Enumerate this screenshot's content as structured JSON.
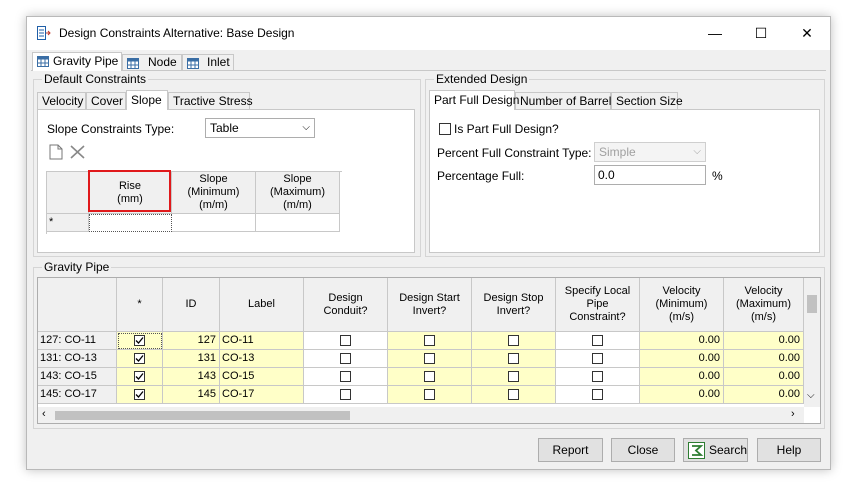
{
  "window": {
    "title": "Design Constraints Alternative:  Base Design",
    "controls": {
      "minimize": "—",
      "maximize": "☐",
      "close": "✕"
    }
  },
  "top_tabs": [
    {
      "label": "Gravity Pipe",
      "icon": "grid-icon"
    },
    {
      "label": "Node",
      "icon": "grid-icon"
    },
    {
      "label": "Inlet",
      "icon": "grid-icon"
    }
  ],
  "default_constraints": {
    "legend": "Default Constraints",
    "tabs": [
      "Velocity",
      "Cover",
      "Slope",
      "Tractive Stress"
    ],
    "slope_constraints_type_label": "Slope Constraints Type:",
    "slope_constraints_type_value": "Table",
    "grid": {
      "columns": [
        {
          "line1": "Rise",
          "line2": "(mm)",
          "line3": ""
        },
        {
          "line1": "Slope",
          "line2": "(Minimum)",
          "line3": "(m/m)"
        },
        {
          "line1": "Slope",
          "line2": "(Maximum)",
          "line3": "(m/m)"
        }
      ],
      "new_row_marker": "*"
    }
  },
  "extended_design": {
    "legend": "Extended Design",
    "tabs": [
      "Part Full Design",
      "Number of Barrels",
      "Section Size"
    ],
    "is_part_full_label": "Is Part Full Design?",
    "percent_full_constraint_label": "Percent Full Constraint Type:",
    "percent_full_constraint_value": "Simple",
    "percentage_full_label": "Percentage Full:",
    "percentage_full_value": "0.0",
    "percentage_unit": "%"
  },
  "gravity_pipe": {
    "legend": "Gravity Pipe",
    "columns": {
      "star": "*",
      "id": "ID",
      "label": "Label",
      "design_conduit": [
        "Design",
        "Conduit?"
      ],
      "design_start_invert": [
        "Design Start",
        "Invert?"
      ],
      "design_stop_invert": [
        "Design Stop",
        "Invert?"
      ],
      "specify_local": [
        "Specify Local",
        "Pipe",
        "Constraint?"
      ],
      "vel_min": [
        "Velocity",
        "(Minimum)",
        "(m/s)"
      ],
      "vel_max": [
        "Velocity",
        "(Maximum)",
        "(m/s)"
      ]
    },
    "rows": [
      {
        "header": "127: CO-11",
        "checked": true,
        "id": "127",
        "label": "CO-11",
        "vel_min": "0.00",
        "vel_max": "0.00"
      },
      {
        "header": "131: CO-13",
        "checked": true,
        "id": "131",
        "label": "CO-13",
        "vel_min": "0.00",
        "vel_max": "0.00"
      },
      {
        "header": "143: CO-15",
        "checked": true,
        "id": "143",
        "label": "CO-15",
        "vel_min": "0.00",
        "vel_max": "0.00"
      },
      {
        "header": "145: CO-17",
        "checked": true,
        "id": "145",
        "label": "CO-17",
        "vel_min": "0.00",
        "vel_max": "0.00"
      }
    ]
  },
  "buttons": {
    "report": "Report",
    "close": "Close",
    "search": "Search",
    "help": "Help"
  }
}
